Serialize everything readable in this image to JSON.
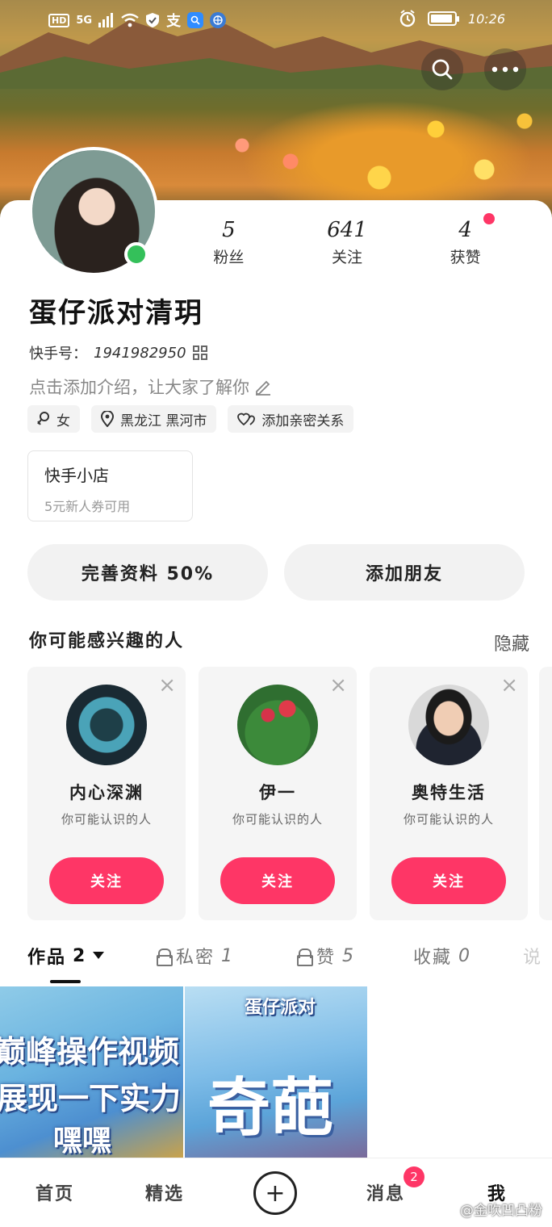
{
  "status_bar": {
    "network": "5G",
    "hd": "HD",
    "alipay": "支",
    "time": "10:26"
  },
  "profile": {
    "nickname": "蛋仔派对清玥",
    "kuaishou_id_label": "快手号：",
    "kuaishou_id": "1941982950",
    "intro_placeholder": "点击添加介绍，让大家了解你",
    "stats": [
      {
        "num": "5",
        "label": "粉丝"
      },
      {
        "num": "641",
        "label": "关注"
      },
      {
        "num": "4",
        "label": "获赞"
      }
    ],
    "tags": {
      "gender": "女",
      "location": "黑龙江  黑河市",
      "relation": "添加亲密关系"
    }
  },
  "shop": {
    "title": "快手小店",
    "subtitle": "5元新人券可用"
  },
  "actions": {
    "complete_profile": "完善资料 50%",
    "add_friend": "添加朋友"
  },
  "recommend": {
    "title": "你可能感兴趣的人",
    "hide": "隐藏",
    "close_glyph": "×",
    "people": [
      {
        "name": "内心深渊",
        "sub": "你可能认识的人",
        "follow": "关注"
      },
      {
        "name": "伊一",
        "sub": "你可能认识的人",
        "follow": "关注"
      },
      {
        "name": "奥特生活",
        "sub": "你可能认识的人",
        "follow": "关注"
      }
    ]
  },
  "tabs": {
    "works": "作品",
    "works_count": "2",
    "private": "私密",
    "private_count": "1",
    "liked": "赞",
    "liked_count": "5",
    "favorites": "收藏",
    "favorites_count": "0",
    "more": "说"
  },
  "thumbnails": {
    "video1_lines": [
      "巅峰操作视频",
      "展现一下实力",
      "嘿嘿"
    ],
    "video2_top": "蛋仔派对",
    "video2_big": "奇葩"
  },
  "bottom_nav": {
    "home": "首页",
    "featured": "精选",
    "plus": "+",
    "messages": "消息",
    "messages_badge": "2",
    "me": "我"
  },
  "watermark": "@金吹凹凸粉",
  "colors": {
    "accent": "#fe3666",
    "online": "#34c05a"
  }
}
